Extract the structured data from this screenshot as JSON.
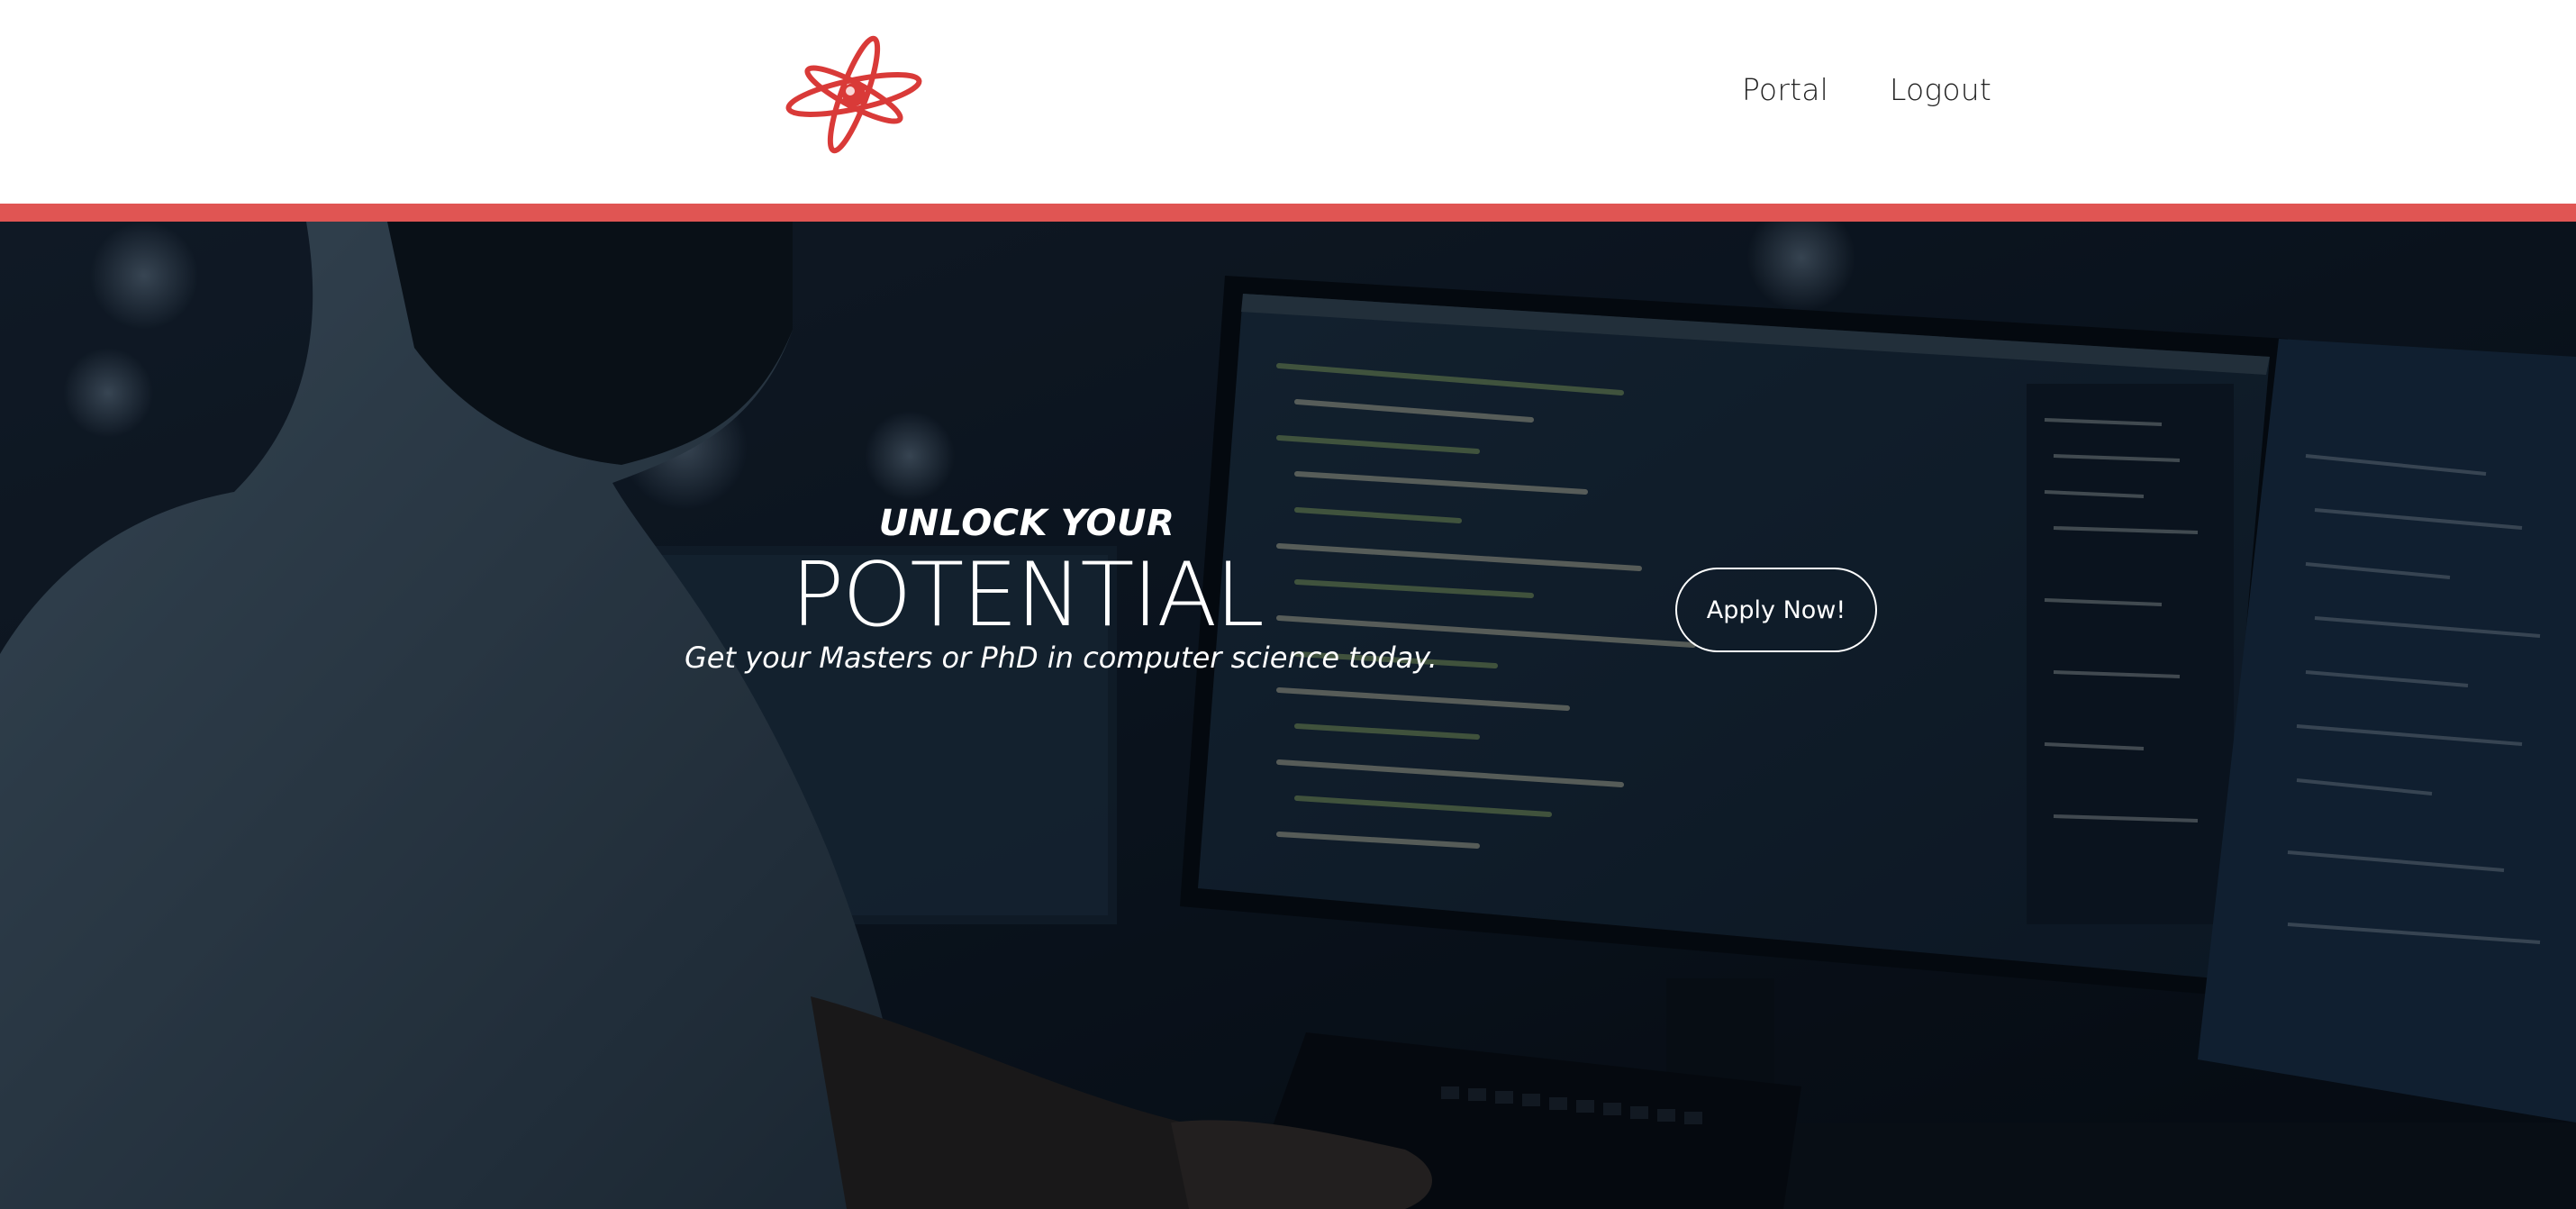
{
  "header": {
    "logo_icon": "atom-icon",
    "nav": [
      {
        "label": "Portal"
      },
      {
        "label": "Logout"
      }
    ]
  },
  "colors": {
    "accent": "#e05553",
    "hero_overlay": "#0d1622",
    "text_light": "#ffffff"
  },
  "hero": {
    "tagline_top": "UNLOCK YOUR",
    "tagline_main": "POTENTIAL",
    "tagline_sub": "Get your Masters or PhD in computer science today.",
    "cta_label": "Apply Now!",
    "background": "person-coding-at-monitors-image"
  }
}
